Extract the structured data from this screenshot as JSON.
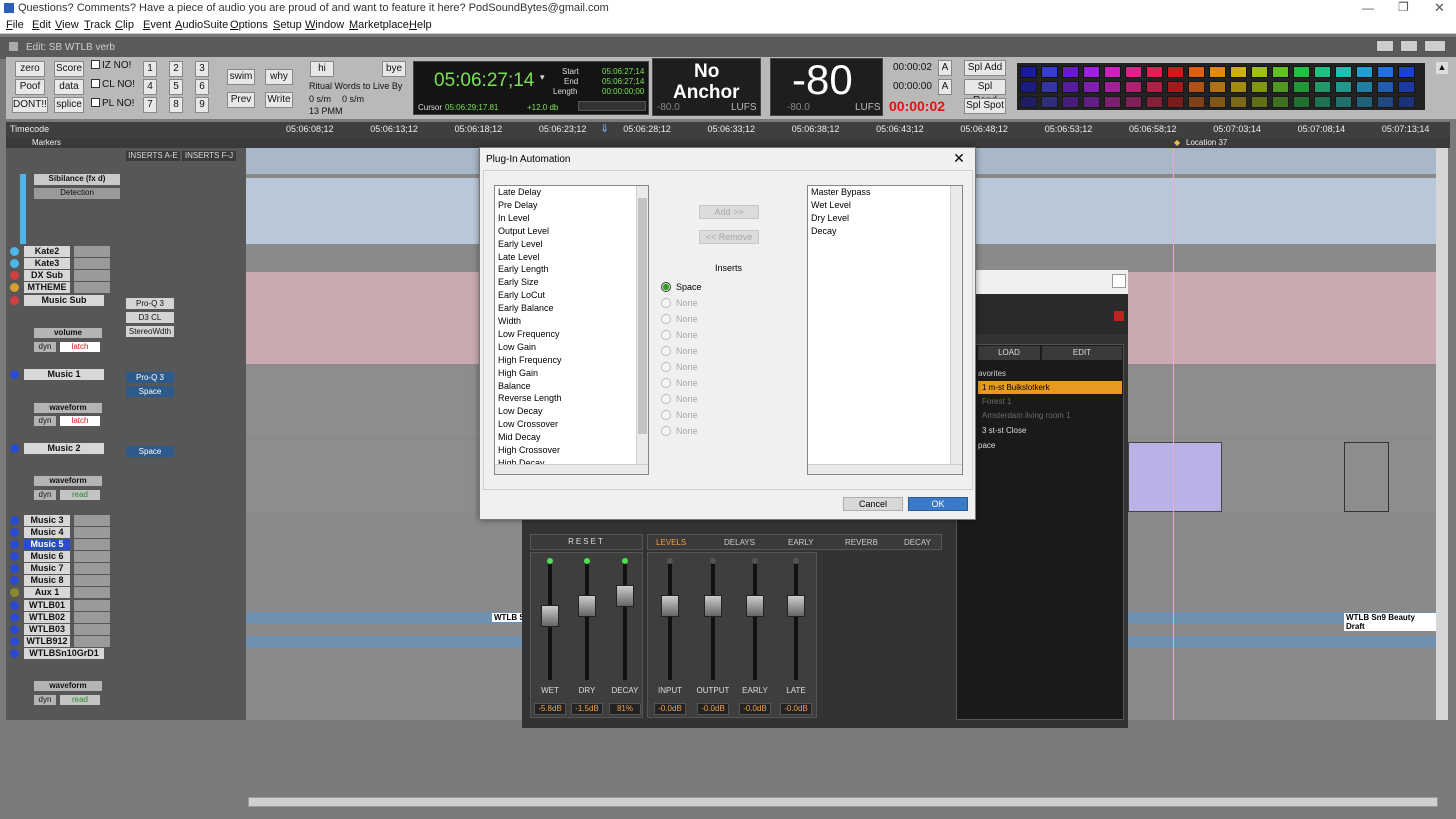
{
  "window_title": "Questions? Comments? Have a piece of audio you are proud of and want to feature it here? PodSoundBytes@gmail.com",
  "menu": [
    "File",
    "Edit",
    "View",
    "Track",
    "Clip",
    "Event",
    "AudioSuite",
    "Options",
    "Setup",
    "Window",
    "Marketplace",
    "Help"
  ],
  "edit_title": "Edit: SB WTLB verb",
  "toolbar": {
    "buttons_left": [
      "zero",
      "Score",
      "Poof",
      "data",
      "DONT!!",
      "splice"
    ],
    "checks": [
      "IZ NO!",
      "CL NO!",
      "PL NO!"
    ],
    "numbers": [
      "1",
      "2",
      "3",
      "4",
      "5",
      "6",
      "7",
      "8",
      "9"
    ],
    "swim": "swim",
    "why": "why",
    "prev": "Prev",
    "write": "Write",
    "hi": "hi",
    "bye": "bye",
    "ritual": "Ritual Words to Live By",
    "os1": "0 s/m",
    "os2": "0 s/m",
    "pm": "13 PMM"
  },
  "counter": {
    "main": "05:06:27;14",
    "start_label": "Start",
    "end_label": "End",
    "length_label": "Length",
    "start": "05:06:27;14",
    "end": "05:06:27;14",
    "length": "00:00:00;00",
    "cursor_label": "Cursor",
    "cursor": "05:06:29;17.81",
    "gain": "+12.0 db"
  },
  "loudness": {
    "no_anchor_1": "No",
    "no_anchor_2": "Anchor",
    "left_min": "-80.0",
    "left_unit": "LUFS",
    "big": "-80",
    "right_min": "-80.0",
    "right_unit": "LUFS"
  },
  "timers": {
    "t1": "00:00:02",
    "t2": "00:00:00",
    "t3": "00:00:02",
    "a": "A"
  },
  "spl_buttons": [
    "Spl Add",
    "Spl Rend",
    "Spl Spot"
  ],
  "color_palette": [
    "#1a1aa0",
    "#3b3bd0",
    "#6a1ad0",
    "#a020e0",
    "#d020c0",
    "#e0208a",
    "#e02050",
    "#d01818",
    "#e06010",
    "#e08a10",
    "#d0b010",
    "#a0c010",
    "#60c020",
    "#20c040",
    "#20c080",
    "#20c0b0",
    "#20a0d0",
    "#2070e0",
    "#1a40d0"
  ],
  "ruler": {
    "label": "Timecode",
    "ticks": [
      "05:06:08;12",
      "05:06:13;12",
      "05:06:18;12",
      "05:06:23;12",
      "05:06:28;12",
      "05:06:33;12",
      "05:06:38;12",
      "05:06:43;12",
      "05:06:48;12",
      "05:06:53;12",
      "05:06:58;12",
      "05:07:03;14",
      "05:07:08;14",
      "05:07:13;14"
    ]
  },
  "markers": {
    "label": "Markers",
    "location": "Location 37"
  },
  "inserts_headers": [
    "INSERTS A-E",
    "INSERTS F-J"
  ],
  "sibilance": {
    "name": "Sibilance (fx d)",
    "mode": "Detection"
  },
  "tracks": [
    "Kate2",
    "Kate3",
    "DX Sub",
    "MTHEME",
    "Music Sub",
    "Music 1",
    "Music 2",
    "Music 3",
    "Music 4",
    "Music 5",
    "Music 6",
    "Music 7",
    "Music 8",
    "Aux 1",
    "WTLB01",
    "WTLB02",
    "WTLB03",
    "WTLB912",
    "WTLBSn10GrD1"
  ],
  "track_modes": {
    "music_sub_view": "volume",
    "music_1_view": "waveform",
    "music_2_view": "waveform",
    "wtlb_view": "waveform",
    "latch": "latch",
    "read": "read",
    "dyn": "dyn"
  },
  "inserts": {
    "music_sub": [
      "Pro-Q 3",
      "D3 CL",
      "StereoWdth"
    ],
    "music_1": [
      "Pro-Q 3",
      "Space"
    ],
    "music_2": [
      "Space"
    ]
  },
  "clip_labels": [
    "WTLB S",
    "WTLB Sn9 Beauty Draft"
  ],
  "plugin": {
    "tabs_top": [
      "LOAD",
      "EDIT"
    ],
    "favorites_label": "avorites",
    "presets": [
      "1 m-st Buikslotkerk",
      "Forest 1",
      "Amsterdam living room 1",
      "3 st-st Close",
      "pace"
    ],
    "reset": "RESET",
    "tabs": [
      "LEVELS",
      "DELAYS",
      "EARLY",
      "REVERB",
      "DECAY"
    ],
    "faders": [
      {
        "label": "WET",
        "value": "-5.8dB"
      },
      {
        "label": "DRY",
        "value": "-1.5dB"
      },
      {
        "label": "DECAY",
        "value": "81%"
      },
      {
        "label": "INPUT",
        "value": "-0.0dB"
      },
      {
        "label": "OUTPUT",
        "value": "-0.0dB"
      },
      {
        "label": "EARLY",
        "value": "-0.0dB"
      },
      {
        "label": "LATE",
        "value": "-0.0dB"
      }
    ]
  },
  "dialog": {
    "title": "Plug-In Automation",
    "available": [
      "Late Delay",
      "Pre Delay",
      "In Level",
      "Output Level",
      "Early Level",
      "Late Level",
      "Early Length",
      "Early Size",
      "Early LoCut",
      "Early Balance",
      "Width",
      "Low Frequency",
      "Low Gain",
      "High Frequency",
      "High Gain",
      "Balance",
      "Reverse Length",
      "Low Decay",
      "Low Crossover",
      "Mid Decay",
      "High Crossover",
      "High Decay"
    ],
    "add": "Add >>",
    "remove": "<< Remove",
    "inserts_label": "Inserts",
    "insert_options": [
      "Space",
      "None",
      "None",
      "None",
      "None",
      "None",
      "None",
      "None",
      "None",
      "None"
    ],
    "enabled": [
      "Master Bypass",
      "Wet Level",
      "Dry Level",
      "Decay"
    ],
    "cancel": "Cancel",
    "ok": "OK"
  }
}
